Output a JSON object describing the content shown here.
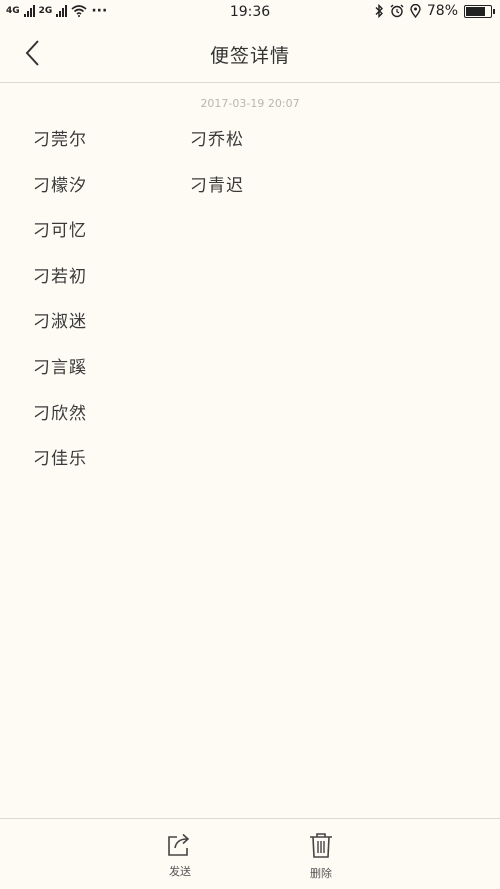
{
  "status_bar": {
    "network1": "4G",
    "network2": "2G",
    "more": "···",
    "time": "19:36",
    "battery_text": "78%",
    "battery_level": 0.78
  },
  "nav": {
    "title": "便签详情",
    "back_icon": "chevron-left-icon"
  },
  "note": {
    "timestamp": "2017-03-19 20:07",
    "left_column": [
      "刁莞尔",
      "刁檬汐",
      "刁可忆",
      "刁若初",
      "刁淑迷",
      "刁言蹊",
      "刁欣然",
      "刁佳乐"
    ],
    "right_column": [
      "刁乔松",
      "刁青迟"
    ]
  },
  "toolbar": {
    "send_label": "发送",
    "delete_label": "删除",
    "send_icon": "share-icon",
    "delete_icon": "trash-icon"
  }
}
